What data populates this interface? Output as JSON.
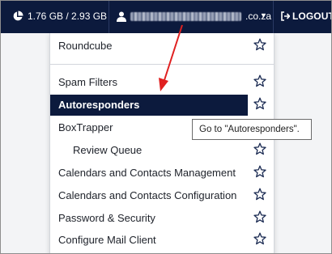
{
  "topbar": {
    "disk_usage": "1.76 GB / 2.93 GB",
    "user_domain": ".co.za",
    "logout_label": "LOGOUT"
  },
  "menu": {
    "items": [
      {
        "label": "Roundcube"
      },
      {
        "label": "Spam Filters"
      },
      {
        "label": "Autoresponders"
      },
      {
        "label": "BoxTrapper"
      },
      {
        "label": "Review Queue"
      },
      {
        "label": "Calendars and Contacts Management"
      },
      {
        "label": "Calendars and Contacts Configuration"
      },
      {
        "label": "Password & Security"
      },
      {
        "label": "Configure Mail Client"
      }
    ]
  },
  "tooltip": {
    "text": "Go to \"Autoresponders\"."
  },
  "colors": {
    "topbar": "#0c1a3d",
    "active_item": "#0c1a3d",
    "annotation_arrow": "#e02020"
  }
}
